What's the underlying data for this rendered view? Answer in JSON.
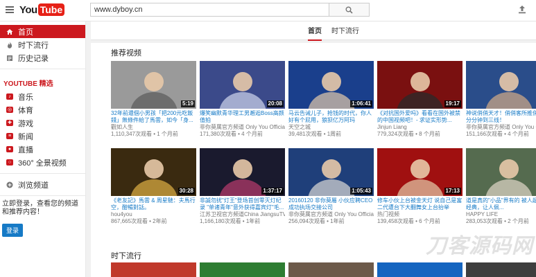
{
  "app": {
    "logo_you": "You",
    "logo_tube": "Tube"
  },
  "search": {
    "value": "www.dyboy.cn",
    "placeholder": ""
  },
  "sidebar": {
    "top_items": [
      {
        "label": "首页",
        "icon": "home-icon"
      },
      {
        "label": "时下流行",
        "icon": "flame-icon"
      },
      {
        "label": "历史记录",
        "icon": "history-icon"
      }
    ],
    "section_title": "YOUTUBE 精选",
    "best_items": [
      {
        "label": "音乐",
        "icon": "music-icon"
      },
      {
        "label": "体育",
        "icon": "sports-icon"
      },
      {
        "label": "游戏",
        "icon": "gaming-icon"
      },
      {
        "label": "新闻",
        "icon": "news-icon"
      },
      {
        "label": "直播",
        "icon": "live-icon"
      },
      {
        "label": "360° 全景视频",
        "icon": "360-icon"
      }
    ],
    "browse_label": "浏览频道",
    "login_prompt": "立即登录，查看您的频道和推荐内容！",
    "login_button": "登录"
  },
  "tabs": [
    "首页",
    "时下流行"
  ],
  "recommended": {
    "title": "推荐视频",
    "videos": [
      {
        "title": "32年前還個小男孩「把200元吃飯錢」無條件給了馬雲，如今「身...",
        "channel": "觀如人生",
        "meta": "1,110,347次观看 • 1 个月前",
        "duration": "5:19"
      },
      {
        "title": "爆笑幽默青华理工男邂逅Boss高颜值拍",
        "channel": "非你莫属官方频道 Only You Official Channel",
        "meta": "171,380次观看 • 4 个月前",
        "duration": "20:08"
      },
      {
        "title": "马云告诫儿子，抢钱的时代，你人好有个屁用，狼狈亿万阿玛",
        "channel": "天空之城",
        "meta": "39,481次观看 • 1周前",
        "duration": "1:06:41"
      },
      {
        "title": "《对抗国外爱吗》看看在国外被禁的中国视频吧！- 求证实形势...",
        "channel": "Jinjun Liang",
        "meta": "779,324次观看 • 8 个月前",
        "duration": "19:17"
      },
      {
        "title": "神说俏俏天才！俏俏客所推俏俏一分分钟到三线！",
        "channel": "非你莫属官方频道 Only You Official Channel",
        "meta": "151,166次观看 • 4 个月前",
        "duration": ""
      },
      {
        "title": "《老友記》馬雲 & 周星馳：夫馬行空，酣暢對話。",
        "channel": "hou4you",
        "meta": "867,665次观看 • 2年前",
        "duration": "30:28"
      },
      {
        "title": "非誠勿扰\"灯王\"登场首创零灭灯纪录 \"单诸青年\"意外获得嘉宾灯\"毛...",
        "channel": "江苏卫视官方频道China JiangsuTV Official Channel",
        "meta": "1,166,180次观看 • 1年前",
        "duration": "1:37:17"
      },
      {
        "title": "20160120 非你莫屬 小伙应聘CEO 成功执场交接公司",
        "channel": "非你莫属官方频道 Only You Official Channel",
        "meta": "256,094次观看 • 1年前",
        "duration": "1:05:43"
      },
      {
        "title": "修车小伙上台被金天灯 说自己是富二代遭台下大翻舞女上台抬举",
        "channel": "热门视频",
        "meta": "139,458次观看 • 6 个月前",
        "duration": "17:13"
      },
      {
        "title": "道是真的\"小品\"界有的 被人超级的经典，让人佩...",
        "channel": "HAPPY LIFE",
        "meta": "283,053次观看 • 2 个月前",
        "duration": ""
      }
    ]
  },
  "trending": {
    "title": "时下流行"
  },
  "watermark": "刀客源码网"
}
